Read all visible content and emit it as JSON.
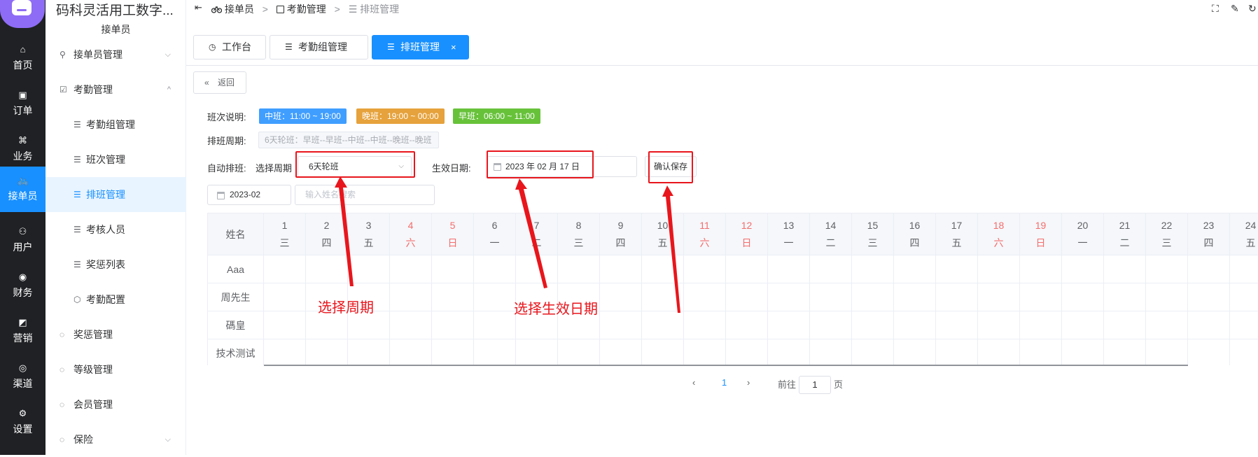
{
  "app": {
    "title": "码科灵活用工数字...",
    "role": "接单员"
  },
  "rail": [
    {
      "label": "首页",
      "icon": "home-icon"
    },
    {
      "label": "订单",
      "icon": "order-icon"
    },
    {
      "label": "业务",
      "icon": "business-icon"
    },
    {
      "label": "接单员",
      "icon": "bike-icon"
    },
    {
      "label": "用户",
      "icon": "user-icon"
    },
    {
      "label": "财务",
      "icon": "finance-icon"
    },
    {
      "label": "营销",
      "icon": "marketing-icon"
    },
    {
      "label": "渠道",
      "icon": "channel-icon"
    },
    {
      "label": "设置",
      "icon": "settings-icon"
    }
  ],
  "menu": [
    {
      "label": "接单员管理",
      "level": 1,
      "arrow": "⌵"
    },
    {
      "label": "考勤管理",
      "level": 1,
      "arrow": "^"
    },
    {
      "label": "考勤组管理",
      "level": 2
    },
    {
      "label": "班次管理",
      "level": 2
    },
    {
      "label": "排班管理",
      "level": 2
    },
    {
      "label": "考核人员",
      "level": 2
    },
    {
      "label": "奖惩列表",
      "level": 2
    },
    {
      "label": "考勤配置",
      "level": 2
    },
    {
      "label": "奖惩管理",
      "level": 1
    },
    {
      "label": "等级管理",
      "level": 1
    },
    {
      "label": "会员管理",
      "level": 1
    },
    {
      "label": "保险",
      "level": 1,
      "arrow": "⌵"
    }
  ],
  "breadcrumb": [
    "接单员",
    ">",
    "考勤管理",
    ">",
    "排班管理"
  ],
  "tabs": [
    {
      "label": "工作台"
    },
    {
      "label": "考勤组管理"
    },
    {
      "label": "排班管理",
      "close": "×"
    }
  ],
  "back_label": "返回",
  "shift": {
    "label": "班次说明:",
    "tags": [
      {
        "text": "中班：11:00 ~ 19:00",
        "color": "#409eff"
      },
      {
        "text": "晚班：19:00 ~ 00:00",
        "color": "#e6a23c"
      },
      {
        "text": "早班：06:00 ~ 11:00",
        "color": "#67c23a"
      }
    ]
  },
  "cycle": {
    "label": "排班周期:",
    "value": "6天轮班：早班--早班--中班--中班--晚班--晚班"
  },
  "auto": {
    "label": "自动排班:",
    "select_label": "选择周期",
    "select_value": "6天轮班",
    "date_label": "生效日期:",
    "date_value": "2023 年 02 月 17 日",
    "save": "确认保存"
  },
  "filter": {
    "month": "2023-02",
    "search_placeholder": "输入姓名搜索"
  },
  "table": {
    "name_header": "姓名",
    "days": [
      {
        "d": "1",
        "w": "三"
      },
      {
        "d": "2",
        "w": "四"
      },
      {
        "d": "3",
        "w": "五"
      },
      {
        "d": "4",
        "w": "六",
        "weekend": true
      },
      {
        "d": "5",
        "w": "日",
        "weekend": true
      },
      {
        "d": "6",
        "w": "一"
      },
      {
        "d": "7",
        "w": "二"
      },
      {
        "d": "8",
        "w": "三"
      },
      {
        "d": "9",
        "w": "四"
      },
      {
        "d": "10",
        "w": "五"
      },
      {
        "d": "11",
        "w": "六",
        "weekend": true
      },
      {
        "d": "12",
        "w": "日",
        "weekend": true
      },
      {
        "d": "13",
        "w": "一"
      },
      {
        "d": "14",
        "w": "二"
      },
      {
        "d": "15",
        "w": "三"
      },
      {
        "d": "16",
        "w": "四"
      },
      {
        "d": "17",
        "w": "五"
      },
      {
        "d": "18",
        "w": "六",
        "weekend": true
      },
      {
        "d": "19",
        "w": "日",
        "weekend": true
      },
      {
        "d": "20",
        "w": "一"
      },
      {
        "d": "21",
        "w": "二"
      },
      {
        "d": "22",
        "w": "三"
      },
      {
        "d": "23",
        "w": "四"
      },
      {
        "d": "24",
        "w": "五"
      }
    ],
    "rows": [
      "Aaa",
      "周先生",
      "碼皇",
      "技术测试"
    ]
  },
  "pager": {
    "page": "1",
    "goto_label": "前往",
    "goto_value": "1",
    "page_unit": "页",
    "prev": "‹",
    "next": "›"
  },
  "annotations": [
    "选择周期",
    "选择生效日期"
  ],
  "colors": {
    "accent": "#1890ff",
    "annotation": "#e8161c",
    "rail": "#1f2124",
    "logo": "#8e6cf5"
  }
}
